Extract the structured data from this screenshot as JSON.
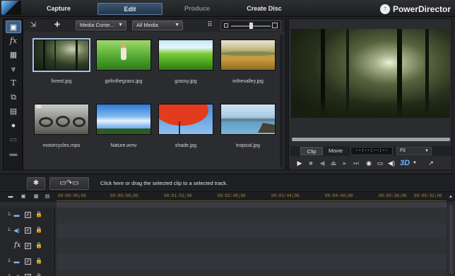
{
  "header": {
    "tabs": [
      {
        "label": "Capture",
        "state": "normal"
      },
      {
        "label": "Edit",
        "state": "active"
      },
      {
        "label": "Produce",
        "state": "disabled"
      },
      {
        "label": "Create Disc",
        "state": "normal"
      }
    ],
    "brand": "PowerDirector",
    "brand_icon": "upload-arrow-icon"
  },
  "tool_column": {
    "items": [
      {
        "name": "media-room-icon",
        "glyph": "🎞"
      },
      {
        "name": "effect-room-icon",
        "glyph": "fx"
      },
      {
        "name": "pip-objects-icon",
        "glyph": "▦"
      },
      {
        "name": "particle-room-icon",
        "glyph": "❄"
      },
      {
        "name": "title-room-icon",
        "glyph": "T"
      },
      {
        "name": "transition-room-icon",
        "glyph": "⧉"
      },
      {
        "name": "audio-mixing-icon",
        "glyph": "▤"
      },
      {
        "name": "voice-over-icon",
        "glyph": "🎙"
      },
      {
        "name": "chapter-room-icon",
        "glyph": "▭"
      },
      {
        "name": "subtitle-room-icon",
        "glyph": "▬"
      }
    ]
  },
  "library": {
    "content_dropdown": "Media Conte...",
    "filter_dropdown": "All Media",
    "clips": [
      {
        "name": "forest.jpg",
        "selected": true,
        "badge": ""
      },
      {
        "name": "girlinthegrass.jpg",
        "selected": false,
        "badge": ""
      },
      {
        "name": "grassy.jpg",
        "selected": false,
        "badge": ""
      },
      {
        "name": "inthevalley.jpg",
        "selected": false,
        "badge": ""
      },
      {
        "name": "motorcycles.mpo",
        "selected": false,
        "badge": "3D"
      },
      {
        "name": "Nature.wmv",
        "selected": false,
        "badge": ""
      },
      {
        "name": "shade.jpg",
        "selected": false,
        "badge": ""
      },
      {
        "name": "tropical.jpg",
        "selected": false,
        "badge": ""
      }
    ]
  },
  "preview": {
    "mode_clip": "Clip",
    "mode_movie": "Movie",
    "timecode": "--:--:--:--",
    "fit": "Fit",
    "controls_3d": "3D"
  },
  "midbar": {
    "hint": "Click here or drag the selected clip to a selected track."
  },
  "timeline": {
    "ruler_labels": [
      "00:00:00;00",
      "00:00:56;00",
      "00:01:52;00",
      "00:02:48;00",
      "00:03:44;00",
      "00:04:40;00",
      "00:05:36;00",
      "00:06:32;00"
    ],
    "tracks": [
      {
        "number": "1.",
        "type": "video-track-icon",
        "fx": false
      },
      {
        "number": "1.",
        "type": "audio-track-icon",
        "fx": false
      },
      {
        "number": "",
        "type": "",
        "fx": true,
        "fx_label": "fx"
      },
      {
        "number": "2.",
        "type": "video-track-icon",
        "fx": false
      },
      {
        "number": "2.",
        "type": "audio-track-icon",
        "fx": false
      }
    ]
  }
}
